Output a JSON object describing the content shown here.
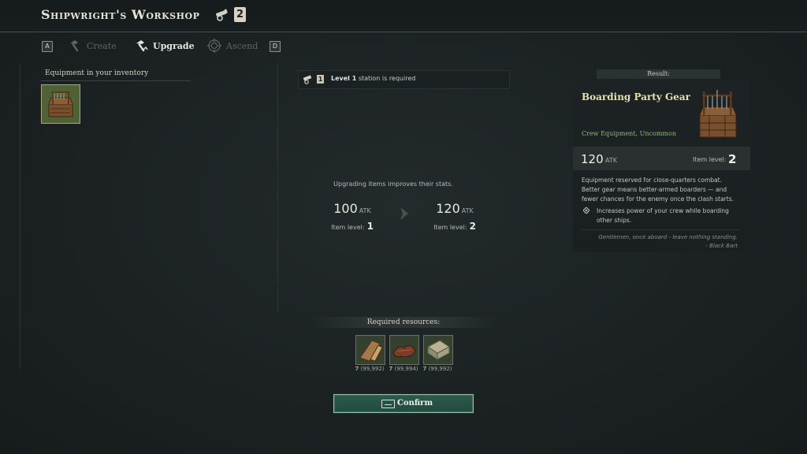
{
  "header": {
    "title": "Shipwright's Workshop",
    "station_level": "2",
    "icon": "cannon-icon"
  },
  "tabs": {
    "prev_key": "A",
    "next_key": "D",
    "items": [
      {
        "label": "Create",
        "icon": "hammer-icon",
        "state": "disabled"
      },
      {
        "label": "Upgrade",
        "icon": "hammer-upgrade-icon",
        "state": "active"
      },
      {
        "label": "Ascend",
        "icon": "ascend-emblem-icon",
        "state": "disabled"
      }
    ]
  },
  "inventory": {
    "label": "Equipment in your inventory",
    "items": [
      {
        "name": "Boarding Party Gear",
        "icon": "crate-icon",
        "selected": true
      }
    ]
  },
  "station_requirement": {
    "level": "1",
    "level_text": "Level 1",
    "suffix": "station is required"
  },
  "upgrade": {
    "note": "Upgrading items improves their stats.",
    "before": {
      "atk": "100",
      "unit": "ATK",
      "level_label": "Item level:",
      "level": "1"
    },
    "after": {
      "atk": "120",
      "unit": "ATK",
      "level_label": "Item level:",
      "level": "2"
    }
  },
  "resources": {
    "label": "Required resources:",
    "items": [
      {
        "icon": "wood-plank-icon",
        "required": "7",
        "owned": "(99,992)"
      },
      {
        "icon": "leather-icon",
        "required": "7",
        "owned": "(99,994)"
      },
      {
        "icon": "cloth-icon",
        "required": "7",
        "owned": "(99,992)"
      }
    ]
  },
  "confirm": {
    "label": "Confirm"
  },
  "result": {
    "label": "Result:",
    "name": "Boarding Party Gear",
    "type": "Crew Equipment, Uncommon",
    "atk": "120",
    "unit": "ATK",
    "level_label": "Item level:",
    "level": "2",
    "description": "Equipment reserved for close-quarters combat. Better gear means better-armed boarders — and fewer chances for the enemy once the clash starts.",
    "bullet": "Increases power of your crew while boarding other ships.",
    "quote": "Gentlemen, once aboard - leave nothing standing.",
    "quote_author": "- Black Bart"
  },
  "colors": {
    "background": "#1c2223",
    "confirm_button": "#2b5a4c",
    "item_name": "#e5e1b5",
    "item_type": "#8fb870",
    "resource_have": "#7fbf67"
  }
}
